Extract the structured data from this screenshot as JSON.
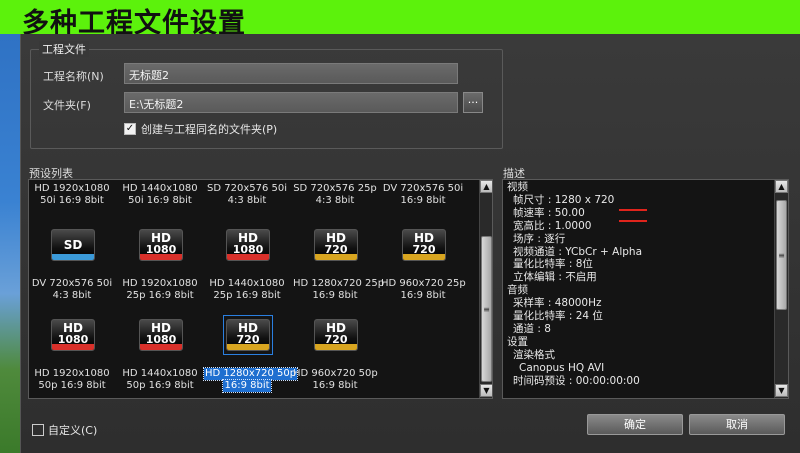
{
  "title": "多种工程文件设置",
  "project_group": {
    "legend": "工程文件",
    "name_label": "工程名称(N)",
    "name_value": "无标题2",
    "folder_label": "文件夹(F)",
    "folder_value": "E:\\无标题2",
    "browse_label": "...",
    "create_folder_label": "创建与工程同名的文件夹(P)",
    "create_folder_checked": "✓"
  },
  "preset_list": {
    "label": "预设列表",
    "items": [
      {
        "line1": "HD 1920x1080",
        "line2": "50i 16:9 8bit",
        "badge": ""
      },
      {
        "line1": "HD 1440x1080",
        "line2": "50i 16:9 8bit",
        "badge": ""
      },
      {
        "line1": "SD 720x576 50i",
        "line2": "4:3 8bit",
        "badge": ""
      },
      {
        "line1": "SD 720x576 25p",
        "line2": "4:3 8bit",
        "badge": ""
      },
      {
        "line1": "DV 720x576 50i",
        "line2": "16:9 8bit",
        "badge": ""
      },
      {
        "line1": "DV 720x576 50i",
        "line2": "4:3 8bit",
        "badge_top": "SD",
        "badge_bottom": "",
        "stripe": "#3b9ad9"
      },
      {
        "line1": "HD 1920x1080",
        "line2": "25p 16:9 8bit",
        "badge_top": "HD",
        "badge_bottom": "1080",
        "stripe": "#d9302a"
      },
      {
        "line1": "HD 1440x1080",
        "line2": "25p 16:9 8bit",
        "badge_top": "HD",
        "badge_bottom": "1080",
        "stripe": "#d9302a"
      },
      {
        "line1": "HD 1280x720 25p",
        "line2": "16:9 8bit",
        "badge_top": "HD",
        "badge_bottom": "720",
        "stripe": "#d8a520"
      },
      {
        "line1": "HD 960x720 25p",
        "line2": "16:9 8bit",
        "badge_top": "HD",
        "badge_bottom": "720",
        "stripe": "#d8a520"
      },
      {
        "line1": "HD 1920x1080",
        "line2": "50p 16:9 8bit",
        "badge_top": "HD",
        "badge_bottom": "1080",
        "stripe": "#d9302a"
      },
      {
        "line1": "HD 1440x1080",
        "line2": "50p 16:9 8bit",
        "badge_top": "HD",
        "badge_bottom": "1080",
        "stripe": "#d9302a"
      },
      {
        "line1": "HD 1280x720 50p",
        "line2": "16:9 8bit",
        "badge_top": "HD",
        "badge_bottom": "720",
        "stripe": "#d8a520",
        "selected": true
      },
      {
        "line1": "HD 960x720 50p",
        "line2": "16:9 8bit",
        "badge_top": "HD",
        "badge_bottom": "720",
        "stripe": "#d8a520"
      }
    ]
  },
  "description": {
    "label": "描述",
    "lines": [
      "视频",
      "帧尺寸 : 1280 x 720",
      "帧速率 : 50.00",
      "宽高比 : 1.0000",
      "场序 : 逐行",
      "视频通道 : YCbCr + Alpha",
      "量化比特率 : 8位",
      "立体编辑 : 不启用",
      "音频",
      "采样率 : 48000Hz",
      "量化比特率 : 24 位",
      "通道 : 8",
      "设置",
      "渲染格式",
      "Canopus HQ AVI",
      "时间码预设 : 00:00:00:00"
    ]
  },
  "custom_label": "自定义(C)",
  "ok_label": "确定",
  "cancel_label": "取消",
  "colors": {
    "accent_green": "#5cf20c",
    "selection_blue": "#1f6fd0",
    "annotation_red": "#e0241c"
  }
}
